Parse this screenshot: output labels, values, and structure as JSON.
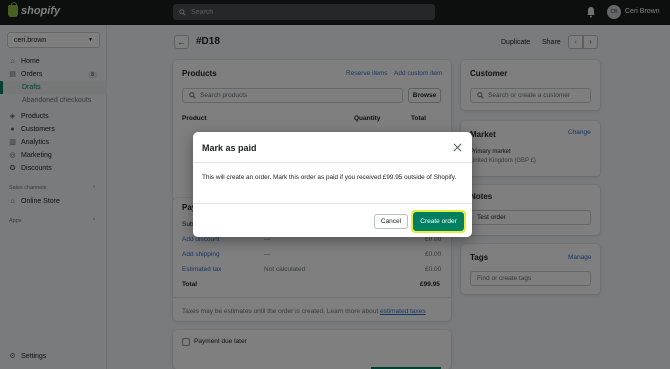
{
  "topbar": {
    "brand": "shopify",
    "search_placeholder": "Search",
    "avatar_initials": "CB",
    "user_name": "Ceri Brown"
  },
  "sidebar": {
    "store_name": "ceri.brown",
    "items": [
      {
        "label": "Home",
        "icon": "home-icon"
      },
      {
        "label": "Orders",
        "icon": "orders-icon",
        "badge": "8"
      },
      {
        "label": "Drafts",
        "sub": true,
        "active": true
      },
      {
        "label": "Abandoned checkouts",
        "sub": true
      },
      {
        "label": "Products",
        "icon": "tag-icon"
      },
      {
        "label": "Customers",
        "icon": "person-icon"
      },
      {
        "label": "Analytics",
        "icon": "bar-chart-icon"
      },
      {
        "label": "Marketing",
        "icon": "target-icon"
      },
      {
        "label": "Discounts",
        "icon": "discount-icon"
      }
    ],
    "sales_channels_label": "Sales channels",
    "online_store": "Online Store",
    "apps_label": "Apps",
    "settings": "Settings"
  },
  "header": {
    "order_id": "#D18",
    "duplicate": "Duplicate",
    "share": "Share"
  },
  "products_card": {
    "title": "Products",
    "reserve_items": "Reserve items",
    "add_custom_item": "Add custom item",
    "search_placeholder": "Search products",
    "browse": "Browse",
    "col_product": "Product",
    "col_quantity": "Quantity",
    "col_total": "Total"
  },
  "payment_card": {
    "title_partial": "Pay",
    "subtotal_partial": "Sub",
    "rows": [
      {
        "label": "Add discount",
        "mid": "—",
        "value": "£0.00"
      },
      {
        "label": "Add shipping",
        "mid": "—",
        "value": "£0.00"
      },
      {
        "label": "Estimated tax",
        "mid": "Not calculated",
        "value": "£0.00"
      }
    ],
    "total_label": "Total",
    "total_value": "£99.95",
    "tax_note": "Taxes may be estimates until the order is created. Learn more about",
    "tax_link": "estimated taxes",
    "payment_due_later": "Payment due later"
  },
  "customer_card": {
    "title": "Customer",
    "search_placeholder": "Search or create a customer"
  },
  "market_card": {
    "title": "Market",
    "change": "Change",
    "line1": "Primary market",
    "line2": "United Kingdom (GBP £)"
  },
  "notes_card": {
    "title": "Notes",
    "value": "Test order"
  },
  "tags_card": {
    "title": "Tags",
    "manage": "Manage",
    "placeholder": "Find or create tags"
  },
  "modal": {
    "title": "Mark as paid",
    "body": "This will create an order. Mark this order as paid if you received £99.95 outside of Shopify.",
    "cancel": "Cancel",
    "confirm": "Create order"
  },
  "colors": {
    "primary": "#008060",
    "link": "#2c6ecb",
    "focus_ring": "#e3ef3a",
    "topbar": "#1a1c1d"
  }
}
